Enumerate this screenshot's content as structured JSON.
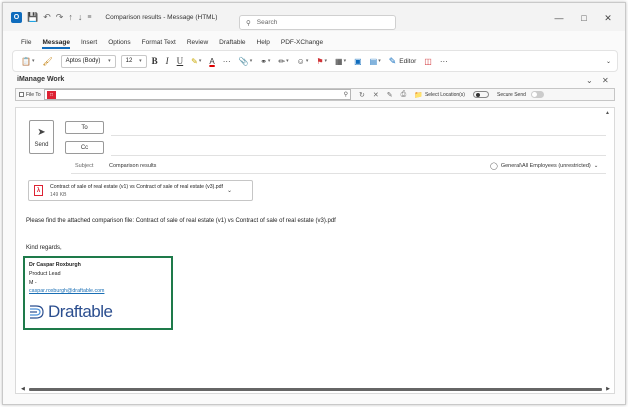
{
  "window": {
    "title": "Comparison results - Message (HTML)",
    "search_placeholder": "Search",
    "icons": [
      "outlook-logo-icon",
      "save-icon",
      "undo-icon",
      "redo-icon",
      "up-icon",
      "down-icon",
      "customize-icon"
    ]
  },
  "menu": {
    "items": [
      "File",
      "Message",
      "Insert",
      "Options",
      "Format Text",
      "Review",
      "Draftable",
      "Help",
      "PDF-XChange"
    ],
    "active": "Message"
  },
  "ribbon": {
    "font_name": "Aptos (Body)",
    "font_size": "12",
    "bold": "B",
    "italic": "I",
    "underline": "U",
    "font_color": "A",
    "more": "···",
    "editor_label": "Editor"
  },
  "imanage": {
    "title": "iManage Work",
    "file_to_label": "File To",
    "select_locations": "Select Location(s)",
    "secure_send": "Secure Send"
  },
  "compose": {
    "send_label": "Send",
    "to_label": "To",
    "cc_label": "Cc",
    "subject_label": "Subject",
    "subject_value": "Comparison results",
    "sensitivity": "General\\All Employees (unrestricted)",
    "attachment": {
      "name": "Contract of sale of real estate (v1) vs Contract of sale of real estate (v3).pdf",
      "size": "149 KB"
    },
    "body": {
      "line1": "Please find the attached comparison file: Contract of sale of real estate (v1) vs Contract of sale of real estate (v3).pdf",
      "line2": "Kind regards,"
    },
    "signature": {
      "name": "Dr Caspar Roxburgh",
      "role": "Product Lead",
      "mobile": "M -",
      "email": "caspar.roxburgh@draftable.com",
      "logo_text": "Draftable",
      "box_color": "#1e7a4a"
    }
  },
  "colors": {
    "accent": "#0f6cbd",
    "logo_blue": "#2b4e8f",
    "link": "#1a6fb5"
  }
}
